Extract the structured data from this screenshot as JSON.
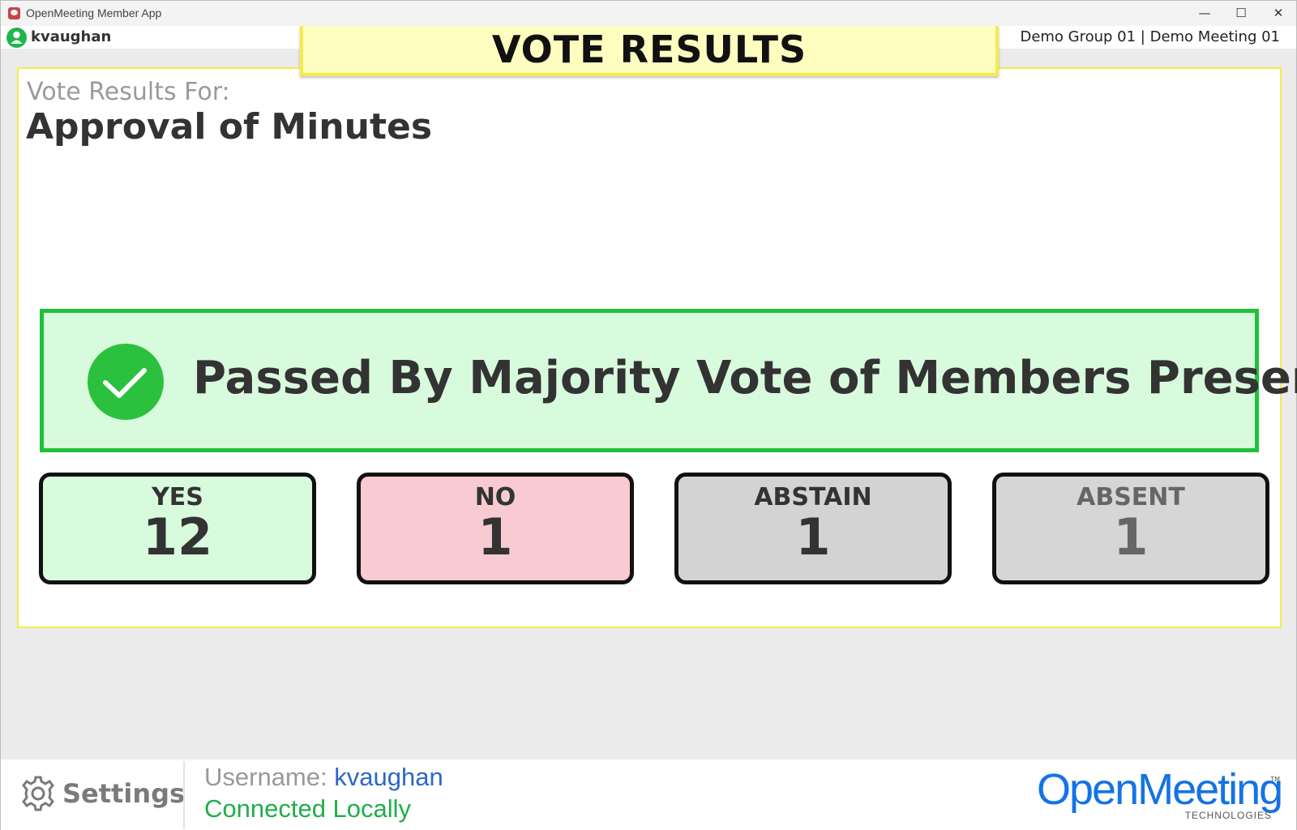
{
  "window": {
    "title": "OpenMeeting Member App",
    "minimize_glyph": "—",
    "maximize_glyph": "☐",
    "close_glyph": "✕"
  },
  "header": {
    "user": "kvaughan",
    "meeting_info": "Demo Group 01 | Demo Meeting 01"
  },
  "banner": {
    "title": "VOTE RESULTS"
  },
  "vote": {
    "results_for_label": "Vote Results For:",
    "motion": "Approval of Minutes",
    "outcome": "Passed By Majority Vote of Members Present",
    "counts": [
      {
        "label": "YES",
        "value": "12",
        "color": "#d8fadd"
      },
      {
        "label": "NO",
        "value": "1",
        "color": "#f8cad1"
      },
      {
        "label": "ABSTAIN",
        "value": "1",
        "color": "#d3d3d3"
      },
      {
        "label": "ABSENT",
        "value": "1",
        "color": "#d6d6d6"
      }
    ]
  },
  "footer": {
    "settings_label": "Settings",
    "username_label": "Username:",
    "username_value": "kvaughan",
    "connection_status": "Connected Locally",
    "logo_text": "OpenMeeting",
    "logo_sub": "TECHNOLOGIES",
    "logo_tm": "TM"
  },
  "colors": {
    "accent_yellow": "#f5ec4c",
    "pass_green": "#1ec138",
    "brand_blue": "#1473e6",
    "connected_green": "#1fae48"
  }
}
